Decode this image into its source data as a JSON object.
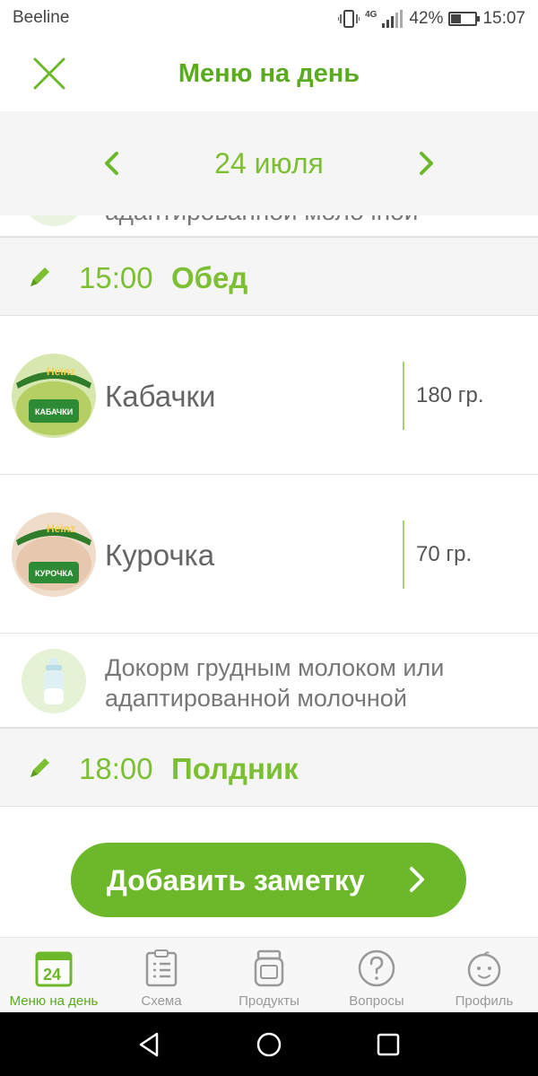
{
  "status_bar": {
    "carrier": "Beeline",
    "network": "4G",
    "battery_percent": "42%",
    "battery_level": 0.42,
    "time": "15:07"
  },
  "header": {
    "title": "Меню на день",
    "close_icon": "close-icon"
  },
  "date_nav": {
    "date": "24 июля",
    "prev_icon": "chevron-left-icon",
    "next_icon": "chevron-right-icon"
  },
  "cut_row": {
    "text": "адаптированной молочной"
  },
  "meals": [
    {
      "time": "15:00",
      "name": "Обед",
      "items": [
        {
          "name": "Кабачки",
          "amount": "180 гр.",
          "jar_label": "КАБАЧКИ",
          "brand": "Heinz"
        },
        {
          "name": "Курочка",
          "amount": "70 гр.",
          "jar_label": "КУРОЧКА",
          "brand": "Heinz"
        }
      ],
      "note": "Докорм грудным молоком или адаптированной молочной"
    },
    {
      "time": "18:00",
      "name": "Полдник"
    }
  ],
  "add_note_button": {
    "label": "Добавить заметку"
  },
  "tabs": [
    {
      "label": "Меню на день",
      "icon": "calendar-icon",
      "icon_text": "24",
      "active": true
    },
    {
      "label": "Схема",
      "icon": "clipboard-icon",
      "active": false
    },
    {
      "label": "Продукты",
      "icon": "jar-icon",
      "active": false
    },
    {
      "label": "Вопросы",
      "icon": "question-icon",
      "active": false
    },
    {
      "label": "Профиль",
      "icon": "baby-face-icon",
      "active": false
    }
  ],
  "colors": {
    "accent": "#5aab1f",
    "accent_light": "#7cbf33",
    "button": "#6cb82a"
  }
}
